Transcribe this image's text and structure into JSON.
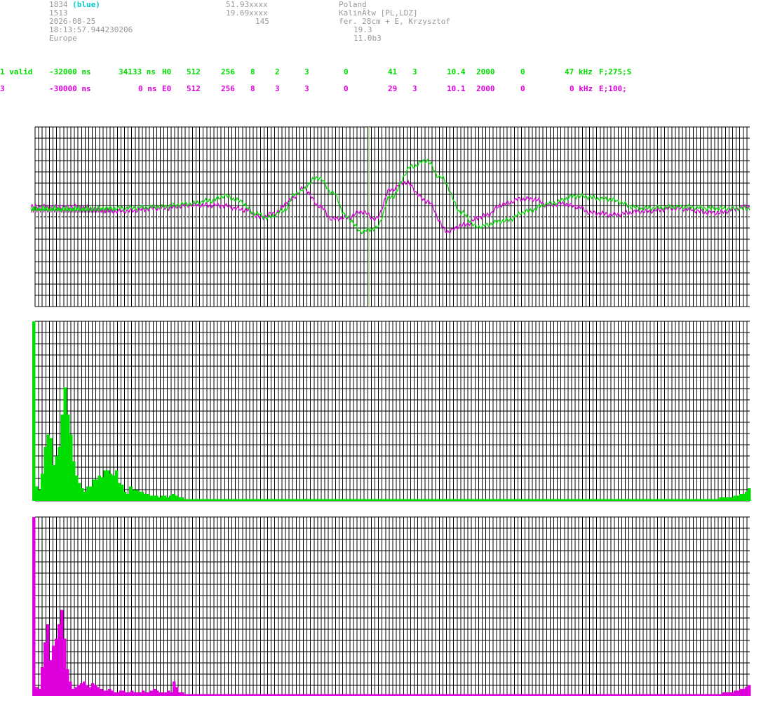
{
  "header": {
    "col1": {
      "id": "1834",
      "tag": "(blue)",
      "num": "1513",
      "date": "2026-08-25",
      "time": "18:13:57.944230206",
      "region": "Europe"
    },
    "col2": {
      "lat": "51.93xxxx",
      "lon": "19.69xxxx",
      "alt": "145"
    },
    "col3": {
      "country": "Poland",
      "station": "KalinÃłw [PL,LDZ]",
      "antenna": "fer. 28cm + E, Krzysztof",
      "v1": "19.3",
      "version": "11.0b3"
    }
  },
  "rows": [
    {
      "c1": "1 valid",
      "c2": "-32000 ns",
      "c3": "34133 ns",
      "c4": "H0",
      "c5": "512",
      "c6": "256",
      "c7": "8",
      "c8": "2",
      "c9": "3",
      "c10": "0",
      "c11": "41",
      "c12": "3",
      "c13": "10.4",
      "c14": "2000",
      "c15": "0",
      "c16": "47 kHz",
      "c17": "F;275;S"
    },
    {
      "c1": "3",
      "c2": "-30000 ns",
      "c3": "0 ns",
      "c4": "E0",
      "c5": "512",
      "c6": "256",
      "c7": "8",
      "c8": "3",
      "c9": "3",
      "c10": "0",
      "c11": "29",
      "c12": "3",
      "c13": "10.1",
      "c14": "2000",
      "c15": "0",
      "c16": "0 kHz",
      "c17": "E;100;"
    }
  ],
  "colors": {
    "green": "#00dd00",
    "magenta": "#dd00dd",
    "grid": "#000000",
    "cursor": "#b0d890",
    "ticks": "#ffffff"
  },
  "chart_data": [
    {
      "type": "line",
      "series": [
        {
          "color": "#00dd00",
          "x": [
            0,
            6,
            12,
            18,
            22,
            25,
            27,
            29,
            31,
            33,
            35,
            37,
            40,
            42,
            44,
            46,
            48,
            50,
            53,
            55,
            57,
            60,
            62,
            66,
            69,
            72,
            76,
            80,
            85,
            90,
            95,
            100
          ],
          "y": [
            0,
            0,
            0,
            0.1,
            0.3,
            0.5,
            0.8,
            0.5,
            -0.3,
            -0.6,
            -0.2,
            1.0,
            2.0,
            1.0,
            -0.6,
            -1.5,
            -1.3,
            0.7,
            2.7,
            3.1,
            2.0,
            -0.3,
            -1.2,
            -0.8,
            -0.2,
            0.3,
            0.8,
            0.6,
            0,
            0.1,
            0,
            0
          ]
        },
        {
          "color": "#dd00dd",
          "x": [
            0,
            6,
            12,
            18,
            22,
            26,
            30,
            32,
            34,
            36,
            38,
            40,
            42,
            44,
            46,
            48,
            50,
            52,
            55,
            58,
            60,
            63,
            66,
            68,
            70,
            72,
            74,
            76,
            78,
            81,
            85,
            90,
            95,
            100
          ],
          "y": [
            0.1,
            0.1,
            -0.2,
            0,
            0.2,
            0.2,
            -0.1,
            -0.6,
            -0.3,
            0.5,
            1.3,
            0.2,
            -0.7,
            -0.6,
            -0.2,
            -0.7,
            1.2,
            1.7,
            0.5,
            -1.5,
            -1.1,
            -0.5,
            0.3,
            0.6,
            0.6,
            0.2,
            0.3,
            0.1,
            -0.3,
            -0.4,
            -0.2,
            0,
            -0.3,
            0.1
          ]
        }
      ]
    },
    {
      "type": "bar",
      "color": "#00dd00",
      "values": [
        100,
        8,
        6,
        15,
        30,
        37,
        35,
        20,
        25,
        30,
        48,
        63,
        48,
        37,
        22,
        14,
        10,
        7,
        5,
        8,
        8,
        12,
        12,
        14,
        13,
        17,
        17,
        15,
        14,
        17,
        10,
        9,
        5,
        4,
        8,
        6,
        6,
        5,
        5,
        4,
        4,
        3,
        3,
        3,
        2,
        3,
        3,
        2,
        3,
        4,
        3,
        2,
        2,
        1,
        1,
        1,
        1,
        1,
        1,
        1,
        1,
        1,
        1,
        1,
        1,
        1,
        1,
        1,
        1,
        1,
        1,
        1,
        1,
        1,
        1,
        1,
        1,
        1,
        1,
        1,
        1,
        1,
        1,
        1,
        1,
        1,
        1,
        1,
        1,
        1,
        1,
        1,
        1,
        1,
        1,
        1,
        1,
        1,
        1,
        1,
        1,
        1,
        1,
        1,
        1,
        1,
        1,
        1,
        1,
        1,
        1,
        1,
        1,
        1,
        1,
        1,
        1,
        1,
        1,
        1,
        1,
        1,
        1,
        1,
        1,
        1,
        1,
        1,
        1,
        1,
        1,
        1,
        1,
        1,
        1,
        1,
        1,
        1,
        1,
        1,
        1,
        1,
        1,
        1,
        1,
        1,
        1,
        1,
        1,
        1,
        1,
        1,
        1,
        1,
        1,
        1,
        1,
        1,
        1,
        1,
        1,
        1,
        1,
        1,
        1,
        1,
        1,
        1,
        1,
        1,
        1,
        1,
        1,
        1,
        1,
        1,
        1,
        1,
        1,
        1,
        1,
        1,
        1,
        1,
        1,
        1,
        1,
        1,
        1,
        1,
        1,
        1,
        1,
        1,
        1,
        1,
        1,
        1,
        1,
        1,
        1,
        1,
        1,
        1,
        1,
        1,
        1,
        1,
        1,
        1,
        1,
        1,
        1,
        1,
        1,
        1,
        1,
        1,
        1,
        1,
        1,
        1,
        1,
        1,
        1,
        1,
        1,
        1,
        1,
        1,
        1,
        1,
        1,
        1,
        1,
        1,
        1,
        1,
        1,
        1,
        1,
        2,
        2,
        2,
        2,
        2,
        3,
        3,
        4,
        4,
        5,
        7
      ]
    },
    {
      "type": "bar",
      "color": "#dd00dd",
      "values": [
        100,
        5,
        4,
        16,
        30,
        40,
        20,
        28,
        32,
        40,
        48,
        32,
        15,
        8,
        4,
        5,
        6,
        7,
        8,
        6,
        5,
        7,
        6,
        5,
        4,
        3,
        3,
        4,
        3,
        2,
        2,
        3,
        3,
        2,
        2,
        3,
        2,
        2,
        2,
        3,
        2,
        2,
        3,
        4,
        3,
        2,
        2,
        2,
        3,
        2,
        8,
        5,
        2,
        2,
        1,
        1,
        1,
        1,
        1,
        1,
        1,
        1,
        1,
        1,
        1,
        1,
        1,
        1,
        1,
        1,
        1,
        1,
        1,
        1,
        1,
        1,
        1,
        1,
        1,
        1,
        1,
        1,
        1,
        1,
        1,
        1,
        1,
        1,
        1,
        1,
        1,
        1,
        1,
        1,
        1,
        1,
        1,
        1,
        1,
        1,
        1,
        1,
        1,
        1,
        1,
        1,
        1,
        1,
        1,
        1,
        1,
        1,
        1,
        1,
        1,
        1,
        1,
        1,
        1,
        1,
        1,
        1,
        1,
        1,
        1,
        1,
        1,
        1,
        1,
        1,
        1,
        1,
        1,
        1,
        1,
        1,
        1,
        1,
        1,
        1,
        1,
        1,
        1,
        1,
        1,
        1,
        1,
        1,
        1,
        1,
        1,
        1,
        1,
        1,
        1,
        1,
        1,
        1,
        1,
        1,
        1,
        1,
        1,
        1,
        1,
        1,
        1,
        1,
        1,
        1,
        1,
        1,
        1,
        1,
        1,
        1,
        1,
        1,
        1,
        1,
        1,
        1,
        1,
        1,
        1,
        1,
        1,
        1,
        1,
        1,
        1,
        1,
        1,
        1,
        1,
        1,
        1,
        1,
        1,
        1,
        1,
        1,
        1,
        1,
        1,
        1,
        1,
        1,
        1,
        1,
        1,
        1,
        1,
        1,
        1,
        1,
        1,
        1,
        1,
        1,
        1,
        1,
        1,
        1,
        1,
        1,
        1,
        1,
        1,
        1,
        1,
        1,
        1,
        1,
        1,
        1,
        1,
        1,
        1,
        1,
        1,
        1,
        1,
        1,
        1,
        1,
        2,
        2,
        2,
        2,
        3,
        3,
        4,
        4,
        5,
        6
      ]
    }
  ]
}
